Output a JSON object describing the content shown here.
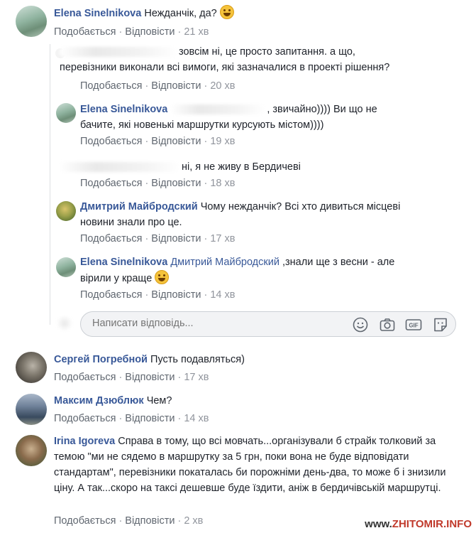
{
  "labels": {
    "like": "Подобається",
    "reply": "Відповісти"
  },
  "comments": [
    {
      "author": "Elena Sinelnikova",
      "text": "Нежданчік, да?",
      "time": "21 хв"
    },
    {
      "author": "",
      "text": "зовсім ні, це просто запитання. а що, перевізники виконали всі вимоги, які зазначалися в проекті рішення?",
      "time": "20 хв"
    },
    {
      "author": "Elena Sinelnikova",
      "text": ", звичайно)))) Ви що не бачите, які новенькі маршрутки курсують містом))))",
      "time": "19 хв"
    },
    {
      "author": "",
      "text": "ні, я не живу в Бердичеві",
      "time": "18 хв"
    },
    {
      "author": "Дмитрий Майбродский",
      "text": "Чому нежданчік? Всі хто дивиться місцеві новини знали про це.",
      "time": "17 хв"
    },
    {
      "author": "Elena Sinelnikova",
      "mention": "Дмитрий Майбродский",
      "text": " ,знали ще з весни - але вірили у краще",
      "time": "14 хв"
    },
    {
      "author": "Сергей Погребной",
      "text": "Пусть подавляться)",
      "time": "17 хв"
    },
    {
      "author": "Максим Дзюблюк",
      "text": "Чем?",
      "time": "14 хв"
    },
    {
      "author": "Irina Igoreva",
      "text": "Справа в тому, що всі мовчать...організували б страйк толковий за темою \"ми не сядемо в маршрутку за 5 грн, поки вона не буде відповідати стандартам\", перевізники покаталась би порожніми день-два, то може б і знизили ціну. А так...скоро на таксі дешевше буде їздити, аніж в бердичівській маршрутці.",
      "time": "2 хв"
    }
  ],
  "reply_box": {
    "placeholder": "Написати відповідь..."
  },
  "icons": [
    "smile-icon",
    "camera-icon",
    "gif-icon",
    "sticker-icon"
  ],
  "watermark": {
    "prefix": "www.",
    "site": "ZHITOMIR.INFO"
  },
  "colors": {
    "link": "#385898",
    "meta": "#606770",
    "time": "#90949c",
    "input_bg": "#f2f3f5"
  }
}
